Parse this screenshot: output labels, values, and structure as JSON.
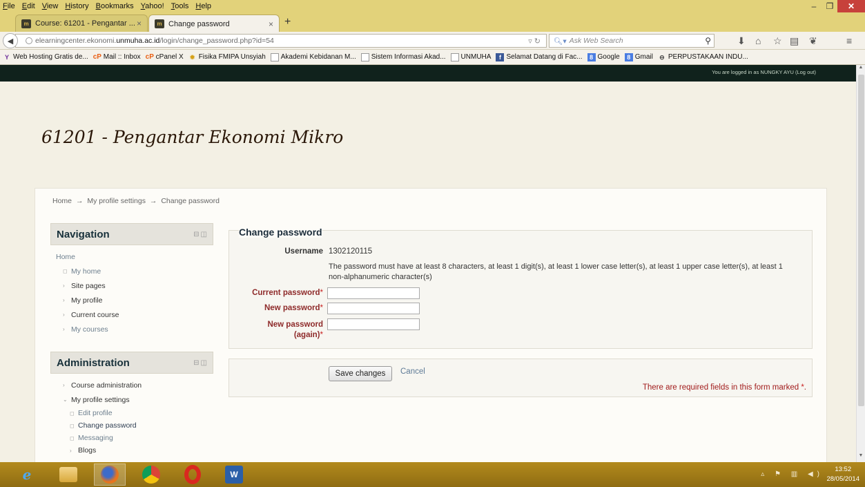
{
  "browser": {
    "menu": [
      "File",
      "Edit",
      "View",
      "History",
      "Bookmarks",
      "Yahoo!",
      "Tools",
      "Help"
    ],
    "tabs": [
      {
        "label": "Course: 61201 - Pengantar ...",
        "favicon": "m",
        "active": false
      },
      {
        "label": "Change password",
        "favicon": "m",
        "active": true
      }
    ],
    "url_prefix": "elearningcenter.ekonomi.",
    "url_domain": "unmuha.ac.id",
    "url_path": "/login/change_password.php?id=54",
    "search_placeholder": "Ask Web Search",
    "bookmarks": [
      {
        "label": "Web Hosting Gratis de...",
        "icon": "y-icon"
      },
      {
        "label": "Mail :: Inbox",
        "icon": "cp-icon"
      },
      {
        "label": "cPanel X",
        "icon": "cp-icon"
      },
      {
        "label": "Fisika FMIPA Unsyiah",
        "icon": "star-icon"
      },
      {
        "label": "Akademi Kebidanan M...",
        "icon": "page-icon"
      },
      {
        "label": "Sistem Informasi Akad...",
        "icon": "page-icon"
      },
      {
        "label": "UNMUHA",
        "icon": "page-icon"
      },
      {
        "label": "Selamat Datang di Fac...",
        "icon": "facebook-icon"
      },
      {
        "label": "Google",
        "icon": "google-icon"
      },
      {
        "label": "Gmail",
        "icon": "google-icon"
      },
      {
        "label": "PERPUSTAKAAN INDU...",
        "icon": "s-icon"
      }
    ]
  },
  "moodle": {
    "login_info": "You are logged in as NUNGKY AYU (Log out)",
    "course_title": "61201 - Pengantar Ekonomi Mikro",
    "breadcrumb": [
      "Home",
      "My profile settings",
      "Change password"
    ],
    "breadcrumb_sep": "→",
    "navigation": {
      "title": "Navigation",
      "items": [
        "Home",
        "My home",
        "Site pages",
        "My profile",
        "Current course",
        "My courses"
      ]
    },
    "administration": {
      "title": "Administration",
      "items": [
        "Course administration",
        "My profile settings",
        "Edit profile",
        "Change password",
        "Messaging",
        "Blogs"
      ]
    },
    "form": {
      "legend": "Change password",
      "username_label": "Username",
      "username_value": "1302120115",
      "rules": "The password must have at least 8 characters, at least 1 digit(s), at least 1 lower case letter(s), at least 1 upper case letter(s), at least 1 non-alphanumeric character(s)",
      "current_label": "Current password",
      "new_label": "New password",
      "new2_label_line1": "New password",
      "new2_label_line2": "(again)",
      "required_star": "*",
      "save_label": "Save changes",
      "cancel_label": "Cancel",
      "required_note": "There are required fields in this form marked"
    }
  },
  "taskbar": {
    "time": "13:52",
    "date": "28/05/2014"
  }
}
